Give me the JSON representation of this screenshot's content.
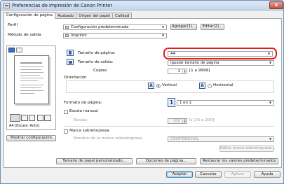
{
  "window": {
    "title": "Preferencias de impresión de Canon Printer",
    "close": "x"
  },
  "tabs": [
    {
      "label": "Configuración de página"
    },
    {
      "label": "Acabado"
    },
    {
      "label": "Origen del papel"
    },
    {
      "label": "Calidad"
    }
  ],
  "profile": {
    "label": "Perfil",
    "value": "Configuración predeterminada",
    "add_button": "Agregar(1)...",
    "edit_button": "Editar(2)..."
  },
  "output_method": {
    "label": "Método de salida",
    "value": "Imprimir"
  },
  "preview": {
    "caption": "A4 [Escala: Auto]",
    "show_settings_button": "Mostrar configuración"
  },
  "page_size": {
    "label": "Tamaño de página:",
    "value": "A4"
  },
  "output_size": {
    "label": "Tamaño de salida:",
    "value": "Igualar tamaño de página"
  },
  "copies": {
    "label": "Copias:",
    "value": "1",
    "range": "[1 a 9999]"
  },
  "orientation": {
    "label": "Orientación",
    "portrait_label": "Vertical",
    "landscape_label": "Horizontal",
    "selected": "Vertical"
  },
  "page_layout": {
    "label": "Formato de página:",
    "value": "1 en 1",
    "badge": "1"
  },
  "manual_scaling": {
    "label": "Escala manual",
    "scale_label": "Escala:",
    "scale_value": "100",
    "scale_range": "% [25 a 200]"
  },
  "watermark": {
    "label": "Marca sobreimpresa",
    "name_label": "Nombre de la marca sobreimpresa:",
    "name_value": "CONFIDENCIAL",
    "edit_button": "Editar marca sobreimpresa..."
  },
  "bottom_buttons": {
    "custom_paper": "Tamaño de papel personalizado...",
    "page_options": "Opciones de página...",
    "restore_defaults": "Restaurar los valores predeterminados"
  },
  "dialog_buttons": {
    "ok": "Aceptar",
    "cancel": "Cancelar",
    "apply": "Aplicar",
    "help": "Ayuda"
  },
  "colors": {
    "highlight_ring": "#e0201b",
    "accent": "#1a5aa8"
  }
}
